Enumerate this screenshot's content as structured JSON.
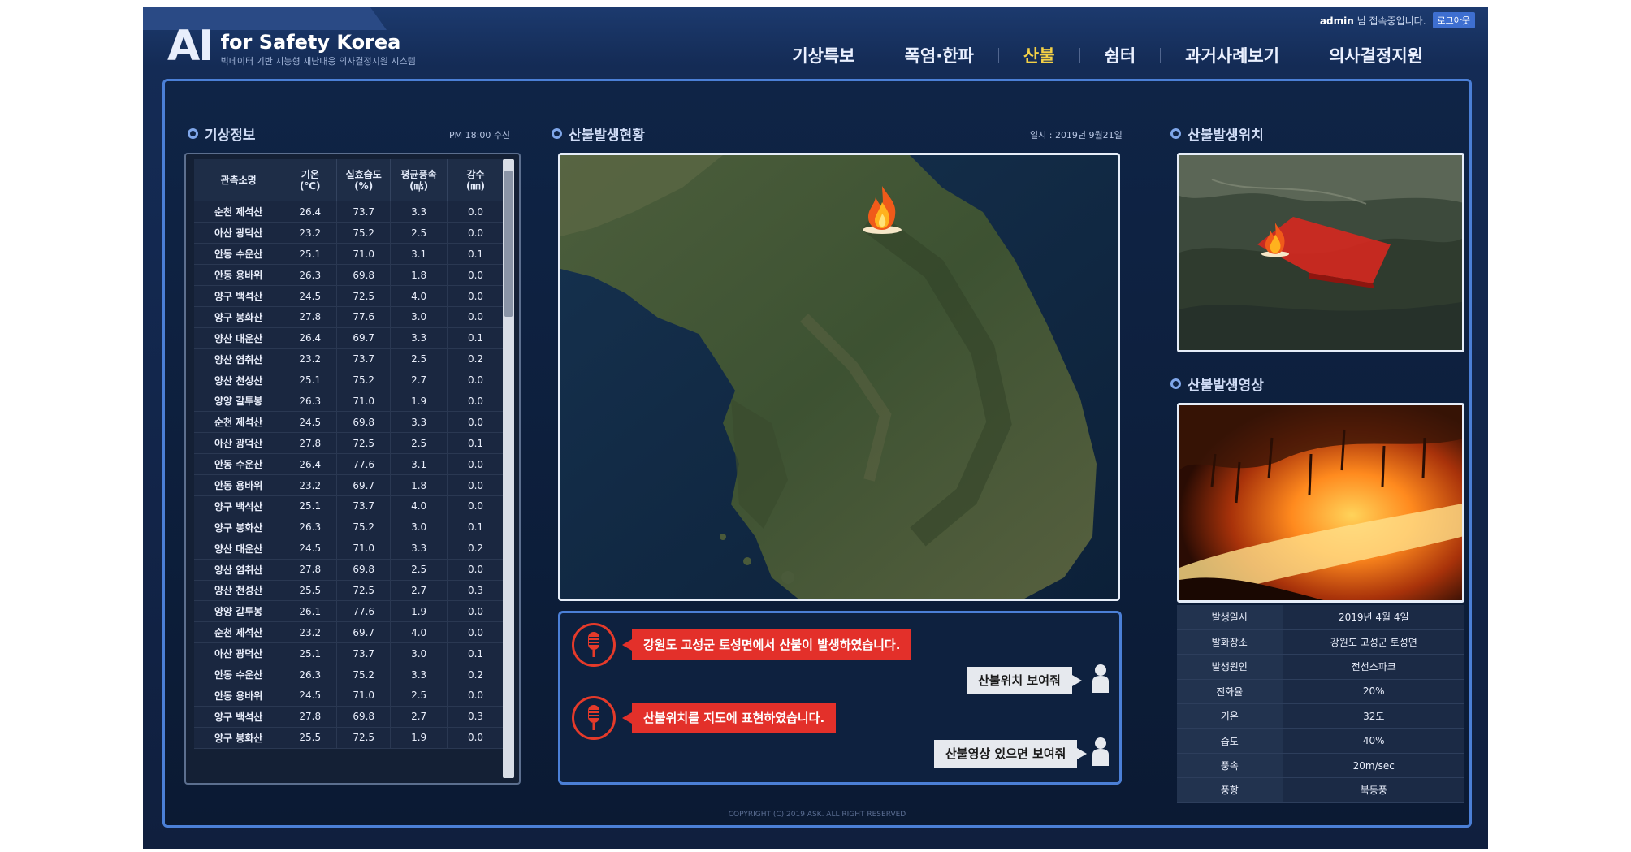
{
  "header": {
    "logo_main": "AI",
    "logo_title": "for Safety Korea",
    "logo_subtitle": "빅데이터 기반 지능형 재난대응 의사결정지원 시스템",
    "user_name": "admin",
    "user_suffix": "님 접속중입니다.",
    "logout_label": "로그아웃"
  },
  "nav": {
    "items": [
      "기상특보",
      "폭염·한파",
      "산불",
      "쉼터",
      "과거사례보기",
      "의사결정지원"
    ],
    "active": "산불"
  },
  "weather": {
    "title": "기상정보",
    "received": "PM 18:00 수신",
    "headers": [
      {
        "l1": "관측소명",
        "l2": ""
      },
      {
        "l1": "기온",
        "l2": "(℃)"
      },
      {
        "l1": "실효습도",
        "l2": "(%)"
      },
      {
        "l1": "평균풍속",
        "l2": "(㎧)"
      },
      {
        "l1": "강수",
        "l2": "(㎜)"
      }
    ],
    "rows": [
      [
        "순천 제석산",
        "26.4",
        "73.7",
        "3.3",
        "0.0"
      ],
      [
        "아산 광덕산",
        "23.2",
        "75.2",
        "2.5",
        "0.0"
      ],
      [
        "안동 수운산",
        "25.1",
        "71.0",
        "3.1",
        "0.1"
      ],
      [
        "안동 용바위",
        "26.3",
        "69.8",
        "1.8",
        "0.0"
      ],
      [
        "양구 백석산",
        "24.5",
        "72.5",
        "4.0",
        "0.0"
      ],
      [
        "양구 봉화산",
        "27.8",
        "77.6",
        "3.0",
        "0.0"
      ],
      [
        "양산 대운산",
        "26.4",
        "69.7",
        "3.3",
        "0.1"
      ],
      [
        "양산 염취산",
        "23.2",
        "73.7",
        "2.5",
        "0.2"
      ],
      [
        "양산 천성산",
        "25.1",
        "75.2",
        "2.7",
        "0.0"
      ],
      [
        "양양 갈투봉",
        "26.3",
        "71.0",
        "1.9",
        "0.0"
      ],
      [
        "순천 제석산",
        "24.5",
        "69.8",
        "3.3",
        "0.0"
      ],
      [
        "아산 광덕산",
        "27.8",
        "72.5",
        "2.5",
        "0.1"
      ],
      [
        "안동 수운산",
        "26.4",
        "77.6",
        "3.1",
        "0.0"
      ],
      [
        "안동 용바위",
        "23.2",
        "69.7",
        "1.8",
        "0.0"
      ],
      [
        "양구 백석산",
        "25.1",
        "73.7",
        "4.0",
        "0.0"
      ],
      [
        "양구 봉화산",
        "26.3",
        "75.2",
        "3.0",
        "0.1"
      ],
      [
        "양산 대운산",
        "24.5",
        "71.0",
        "3.3",
        "0.2"
      ],
      [
        "양산 염취산",
        "27.8",
        "69.8",
        "2.5",
        "0.0"
      ],
      [
        "양산 천성산",
        "25.5",
        "72.5",
        "2.7",
        "0.3"
      ],
      [
        "양양 갈투봉",
        "26.1",
        "77.6",
        "1.9",
        "0.0"
      ],
      [
        "순천 제석산",
        "23.2",
        "69.7",
        "4.0",
        "0.0"
      ],
      [
        "아산 광덕산",
        "25.1",
        "73.7",
        "3.0",
        "0.1"
      ],
      [
        "안동 수운산",
        "26.3",
        "75.2",
        "3.3",
        "0.2"
      ],
      [
        "안동 용바위",
        "24.5",
        "71.0",
        "2.5",
        "0.0"
      ],
      [
        "양구 백석산",
        "27.8",
        "69.8",
        "2.7",
        "0.3"
      ],
      [
        "양구 봉화산",
        "25.5",
        "72.5",
        "1.9",
        "0.0"
      ]
    ]
  },
  "map": {
    "title": "산불발생현황",
    "date": "일시 : 2019년 9월21일"
  },
  "chat": {
    "ai_messages": [
      "강원도 고성군 토성면에서 산불이 발생하였습니다.",
      "산불위치를 지도에 표현하였습니다."
    ],
    "user_messages": [
      "산불위치 보여줘",
      "산불영상 있으면 보여줘"
    ]
  },
  "location": {
    "title": "산불발생위치"
  },
  "video": {
    "title": "산불발생영상"
  },
  "info": [
    {
      "key": "발생일시",
      "value": "2019년 4월 4일"
    },
    {
      "key": "발화장소",
      "value": "강원도 고성군 토성면"
    },
    {
      "key": "발생원인",
      "value": "전선스파크"
    },
    {
      "key": "진화율",
      "value": "20%"
    },
    {
      "key": "기온",
      "value": "32도"
    },
    {
      "key": "습도",
      "value": "40%"
    },
    {
      "key": "풍속",
      "value": "20m/sec"
    },
    {
      "key": "풍향",
      "value": "북동풍"
    }
  ],
  "footer": "COPYRIGHT (C) 2019 ASK. ALL RIGHT RESERVED",
  "colors": {
    "accent": "#4b7fd6",
    "active_nav": "#f3d046",
    "alert": "#e3302a"
  }
}
